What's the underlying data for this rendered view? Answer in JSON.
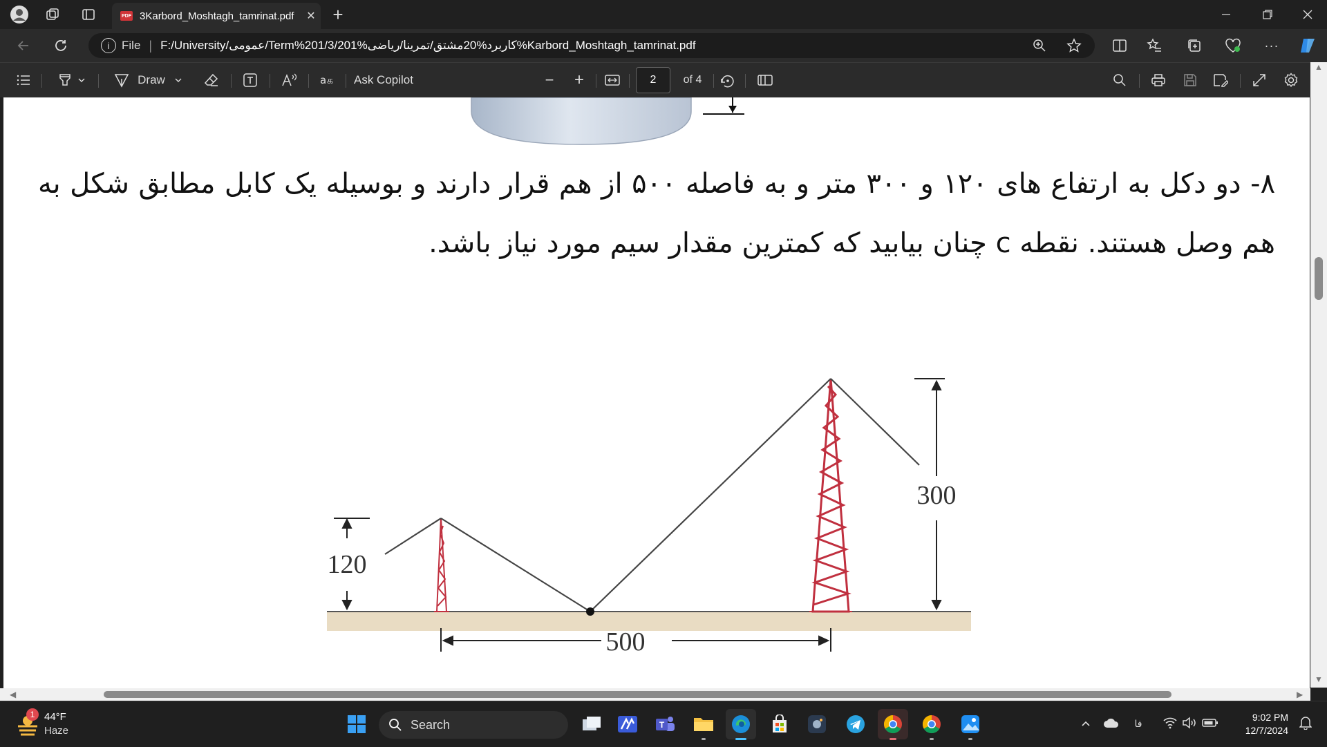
{
  "browser": {
    "tab_title": "3Karbord_Moshtagh_tamrinat.pdf",
    "tab_close": "✕",
    "new_tab": "+",
    "address_label": "File",
    "address_url": "F:/University/عمومی/Term%201/3/کاربرد%20مشتق/تمرینا/ریاضی%201%Karbord_Moshtagh_tamrinat.pdf"
  },
  "pdf_toolbar": {
    "draw_label": "Draw",
    "ask_copilot": "Ask Copilot",
    "page_number": "2",
    "page_total": "of 4",
    "zoom_out": "−",
    "zoom_in": "+"
  },
  "document": {
    "question_number": "۸-",
    "question_text": "دو دکل به ارتفاع های ۱۲۰ و ۳۰۰ متر و به فاصله ۵۰۰ از هم قرار دارند و بوسیله یک کابل مطابق شکل به هم وصل هستند. نقطه c چنان بیابید که کمترین مقدار سیم مورد نیاز باشد.",
    "figure": {
      "height_short": "120",
      "height_tall": "300",
      "distance": "500"
    }
  },
  "taskbar": {
    "weather_temp": "44°F",
    "weather_desc": "Haze",
    "weather_badge": "1",
    "search_label": "Search",
    "lang": "فا",
    "time": "9:02 PM",
    "date": "12/7/2024"
  },
  "colors": {
    "tower": "#c0303f",
    "ground": "#e9dcc3",
    "accent": "#0078d4"
  }
}
